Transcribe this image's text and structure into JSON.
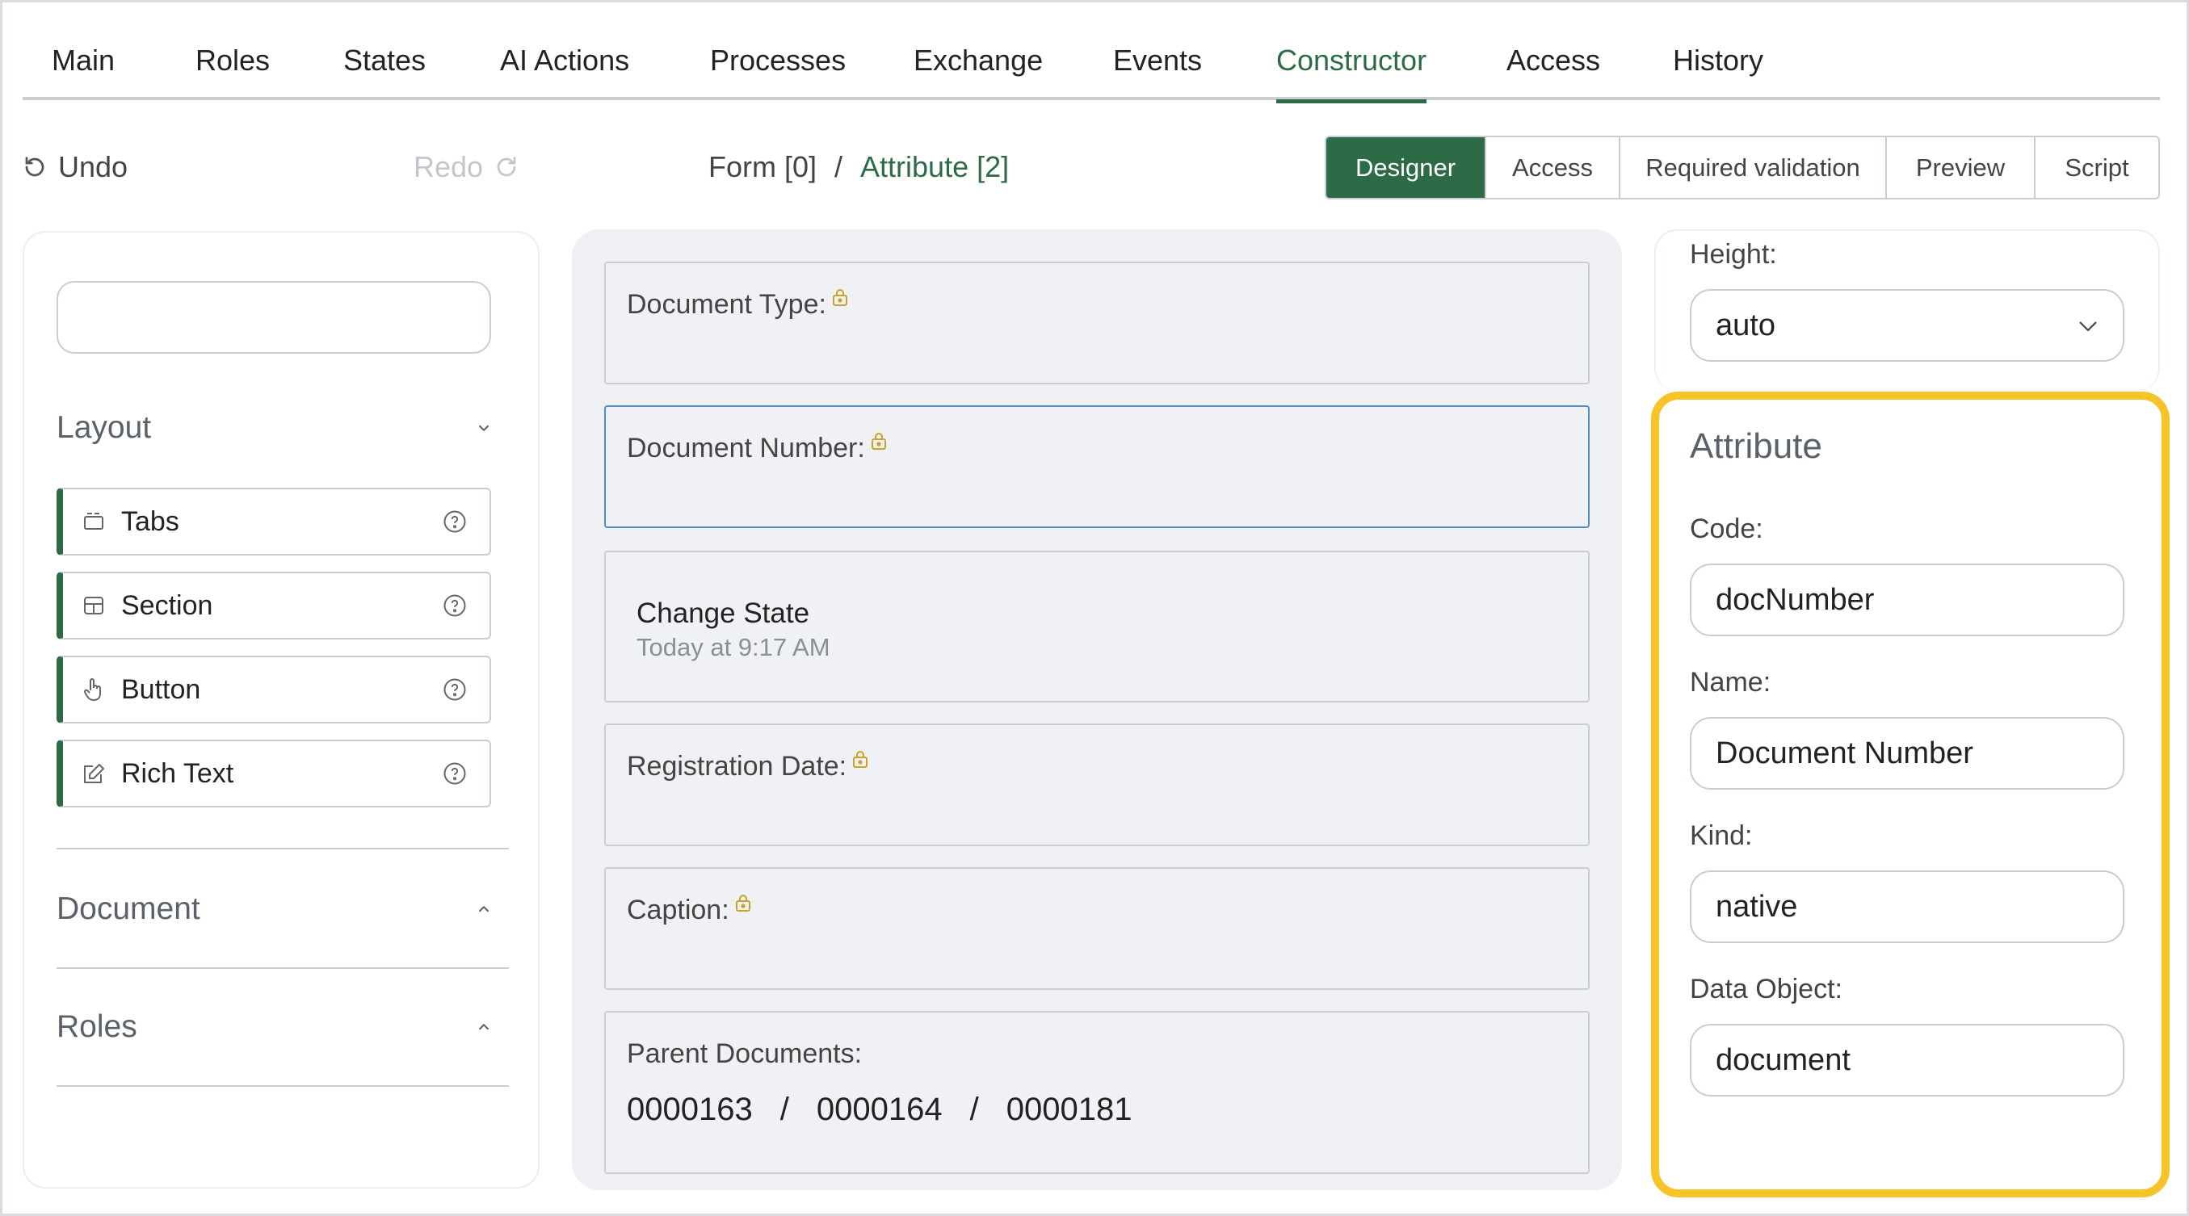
{
  "nav": {
    "tabs": [
      {
        "label": "Main"
      },
      {
        "label": "Roles"
      },
      {
        "label": "States"
      },
      {
        "label": "AI Actions"
      },
      {
        "label": "Processes"
      },
      {
        "label": "Exchange"
      },
      {
        "label": "Events"
      },
      {
        "label": "Constructor",
        "active": true
      },
      {
        "label": "Access"
      },
      {
        "label": "History"
      }
    ]
  },
  "toolbar": {
    "undo_label": "Undo",
    "redo_label": "Redo",
    "breadcrumb": {
      "form": "Form [0]",
      "separator": "/",
      "attribute": "Attribute [2]"
    },
    "modes": [
      {
        "label": "Designer",
        "active": true
      },
      {
        "label": "Access"
      },
      {
        "label": "Required validation"
      },
      {
        "label": "Preview"
      },
      {
        "label": "Script"
      }
    ]
  },
  "left_panel": {
    "search": {
      "value": "",
      "placeholder": ""
    },
    "layout_group": {
      "title": "Layout",
      "items": [
        {
          "label": "Tabs",
          "icon": "tabs-icon"
        },
        {
          "label": "Section",
          "icon": "section-icon"
        },
        {
          "label": "Button",
          "icon": "pointer-hand-icon"
        },
        {
          "label": "Rich Text",
          "icon": "edit-icon"
        }
      ]
    },
    "document_group": {
      "title": "Document"
    },
    "roles_group": {
      "title": "Roles"
    }
  },
  "canvas": {
    "fields": [
      {
        "label": "Document Type:",
        "locked": true
      },
      {
        "label": "Document Number:",
        "locked": true,
        "selected": true
      },
      {
        "title": "Change State",
        "subtitle": "Today at 9:17 AM"
      },
      {
        "label": "Registration Date:",
        "locked": true
      },
      {
        "label": "Caption:",
        "locked": true
      },
      {
        "label": "Parent Documents:",
        "values": [
          "0000163",
          "0000164",
          "0000181"
        ],
        "separator": "/"
      }
    ]
  },
  "right_panel": {
    "height_label": "Height:",
    "height_value": "auto",
    "attribute": {
      "title": "Attribute",
      "code_label": "Code:",
      "code_value": "docNumber",
      "name_label": "Name:",
      "name_value": "Document Number",
      "kind_label": "Kind:",
      "kind_value": "native",
      "data_object_label": "Data Object:",
      "data_object_value": "document"
    }
  },
  "colors": {
    "accent": "#2c6b46",
    "highlight": "#f7c427",
    "selected_border": "#4f8fc6",
    "lock": "#c9a227"
  }
}
